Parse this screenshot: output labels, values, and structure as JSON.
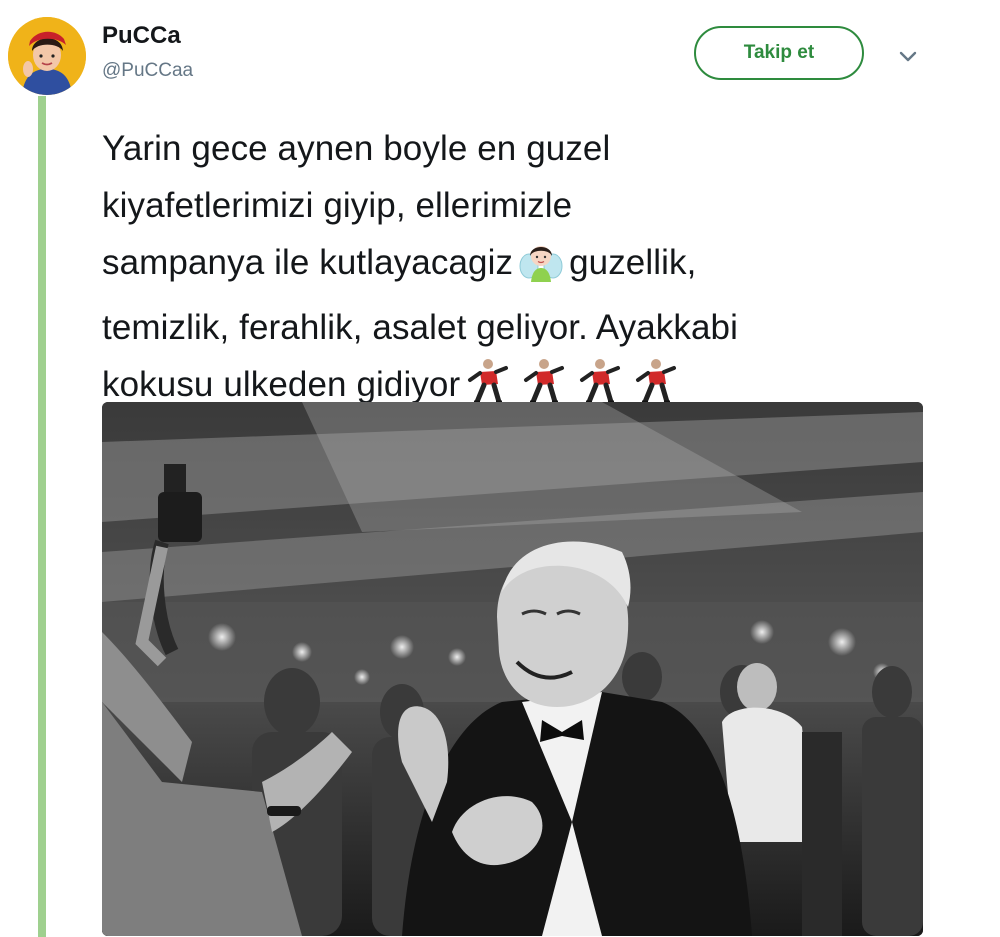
{
  "user": {
    "display_name": "PuCCa",
    "handle": "@PuCCaa"
  },
  "actions": {
    "follow_label": "Takip et"
  },
  "tweet": {
    "lines": [
      "Yarin gece aynen boyle en guzel",
      "kiyafetlerimizi giyip, ellerimizle",
      "sampanya ile kutlayacagiz",
      "guzellik,",
      "temizlik, ferahlik, asalet geliyor. Ayakkabi",
      "kokusu ulkeden gidiyor"
    ]
  },
  "icons": {
    "caret": "chevron-down-icon",
    "fairy": "fairy-emoji",
    "dancer": "man-dancing-emoji"
  },
  "colors": {
    "follow_accent": "#2e8b3e",
    "thread_line": "#9fd08f",
    "handle_text": "#657786"
  }
}
